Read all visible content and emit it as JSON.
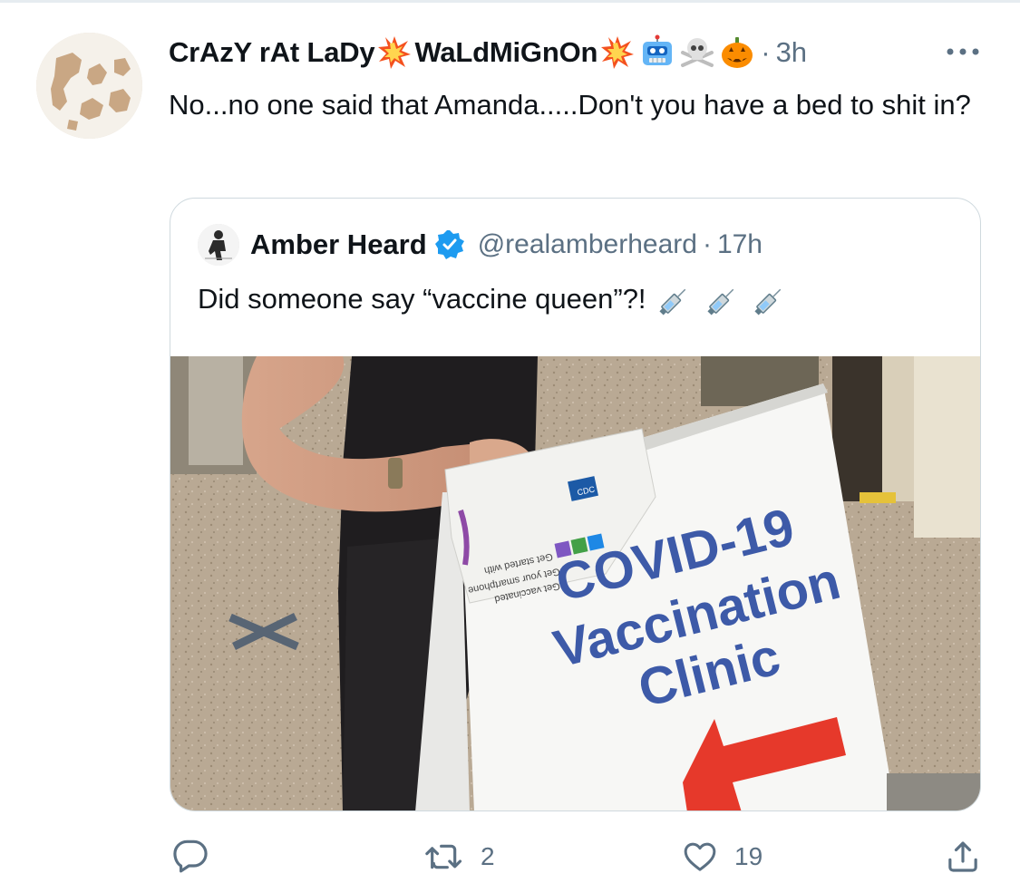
{
  "tweet": {
    "display_name_part1": "CrAzY rAt LaDy",
    "display_name_part2": "WaLdMiGnOn",
    "emojis": [
      "collision-emoji",
      "collision-emoji",
      "robot-emoji",
      "skull-crossbones-emoji",
      "jack-o-lantern-emoji"
    ],
    "meta_dot": "·",
    "time": "3h",
    "text": "No...no one said that Amanda.....Don't you have a bed to shit in?"
  },
  "quote": {
    "name": "Amber Heard",
    "verified": true,
    "handle": "@realamberheard",
    "meta_dot": "·",
    "time": "17h",
    "text": "Did someone say “vaccine queen”?!",
    "emojis": [
      "syringe-emoji",
      "syringe-emoji",
      "syringe-emoji"
    ],
    "image": {
      "sign_line1": "COVID-19",
      "sign_line2": "Vaccination",
      "sign_line3": "Clinic",
      "paper_text1": "Get started with",
      "paper_text2": "Get your smartphone",
      "paper_text3": "Get vaccinated",
      "cdc_label": "CDC"
    }
  },
  "actions": {
    "reply_count": "",
    "retweet_count": "2",
    "like_count": "19"
  },
  "colors": {
    "text_primary": "#0f1419",
    "text_secondary": "#5b7083",
    "verified_blue": "#1d9bf0",
    "border": "#cfd9de",
    "sign_blue": "#3d5aa8",
    "arrow_red": "#e6392b"
  }
}
